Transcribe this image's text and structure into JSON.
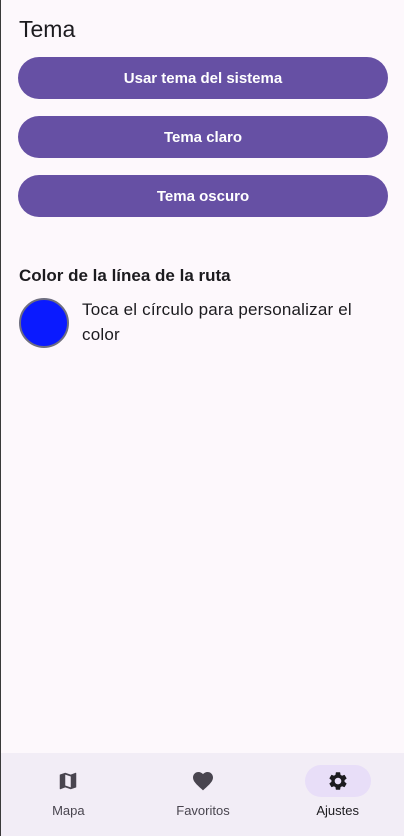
{
  "theme": {
    "title": "Tema",
    "buttons": [
      {
        "label": "Usar tema del sistema"
      },
      {
        "label": "Tema claro"
      },
      {
        "label": "Tema oscuro"
      }
    ]
  },
  "route_color": {
    "title": "Color de la línea de la ruta",
    "hint": "Toca el círculo para personalizar el color",
    "color": "#0a1aff"
  },
  "navbar": {
    "items": [
      {
        "label": "Mapa",
        "icon": "map-icon",
        "active": false
      },
      {
        "label": "Favoritos",
        "icon": "heart-icon",
        "active": false
      },
      {
        "label": "Ajustes",
        "icon": "gear-icon",
        "active": true
      }
    ]
  },
  "colors": {
    "primary": "#6650a4",
    "background": "#fdf8fc",
    "navbar": "#f2edf6",
    "active_indicator": "#e8def8"
  }
}
